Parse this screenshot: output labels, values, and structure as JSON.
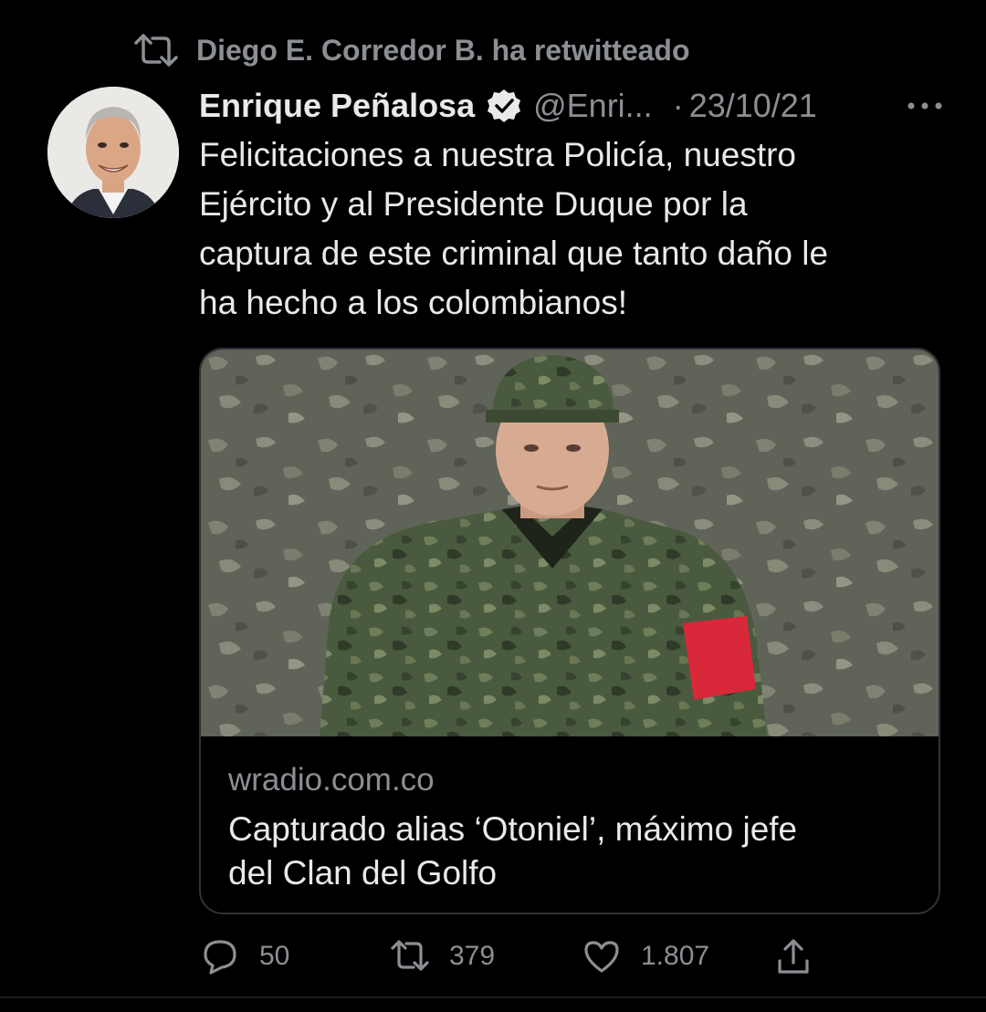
{
  "retweet": {
    "icon": "retweet-icon",
    "text": "Diego E. Corredor B. ha retwitteado"
  },
  "tweet": {
    "author": {
      "display_name": "Enrique Peñalosa",
      "verified": true,
      "handle": "@Enri...",
      "avatar_icon": "avatar"
    },
    "separator": "·",
    "date": "23/10/21",
    "text_lines": [
      "Felicitaciones a nuestra Policía, nuestro",
      "Ejército y al Presidente Duque por la",
      "captura de este criminal que tanto daño le",
      "ha hecho a los colombianos!"
    ],
    "card": {
      "domain": "wradio.com.co",
      "title_lines": [
        "Capturado alias ‘Otoniel’, máximo jefe",
        "del Clan del Golfo"
      ]
    },
    "actions": {
      "replies": "50",
      "retweets": "379",
      "likes": "1.807"
    }
  },
  "colors": {
    "background": "#000000",
    "primary_text": "#e7e9ea",
    "secondary_text": "#8b8f94",
    "card_border": "#2f3336",
    "armband_red": "#d8283a"
  }
}
